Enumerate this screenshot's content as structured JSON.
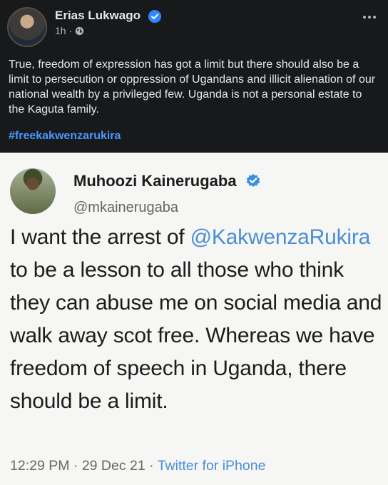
{
  "post": {
    "author": "Erias Lukwago",
    "time": "1h",
    "separator": "·",
    "text": "True, freedom of expression has got a limit but there should also be a limit to persecution or oppression of Ugandans and illicit alienation of our national wealth by a privileged few. Uganda is not a personal estate to the Kaguta family.",
    "hashtag": "#freekakwenzarukira"
  },
  "tweet": {
    "name": "Muhoozi Kainerugaba",
    "handle": "@mkainerugaba",
    "text_before": "I want the arrest of ",
    "mention": "@KakwenzaRukira",
    "text_after": " to be a lesson to all those who think they can abuse me on social media and walk away scot free. Whereas we have freedom of speech in Uganda, there should be a limit.",
    "time": "12:29 PM",
    "dot1": " · ",
    "date": "29 Dec 21",
    "dot2": " · ",
    "source": "Twitter for iPhone"
  },
  "colors": {
    "background": "#18191a",
    "fb_verified": "#2d88ff",
    "hashtag": "#4599ff",
    "tweet_link": "#4a8ed6"
  },
  "icons": [
    "verified-badge-icon",
    "globe-icon",
    "more-options-icon"
  ]
}
